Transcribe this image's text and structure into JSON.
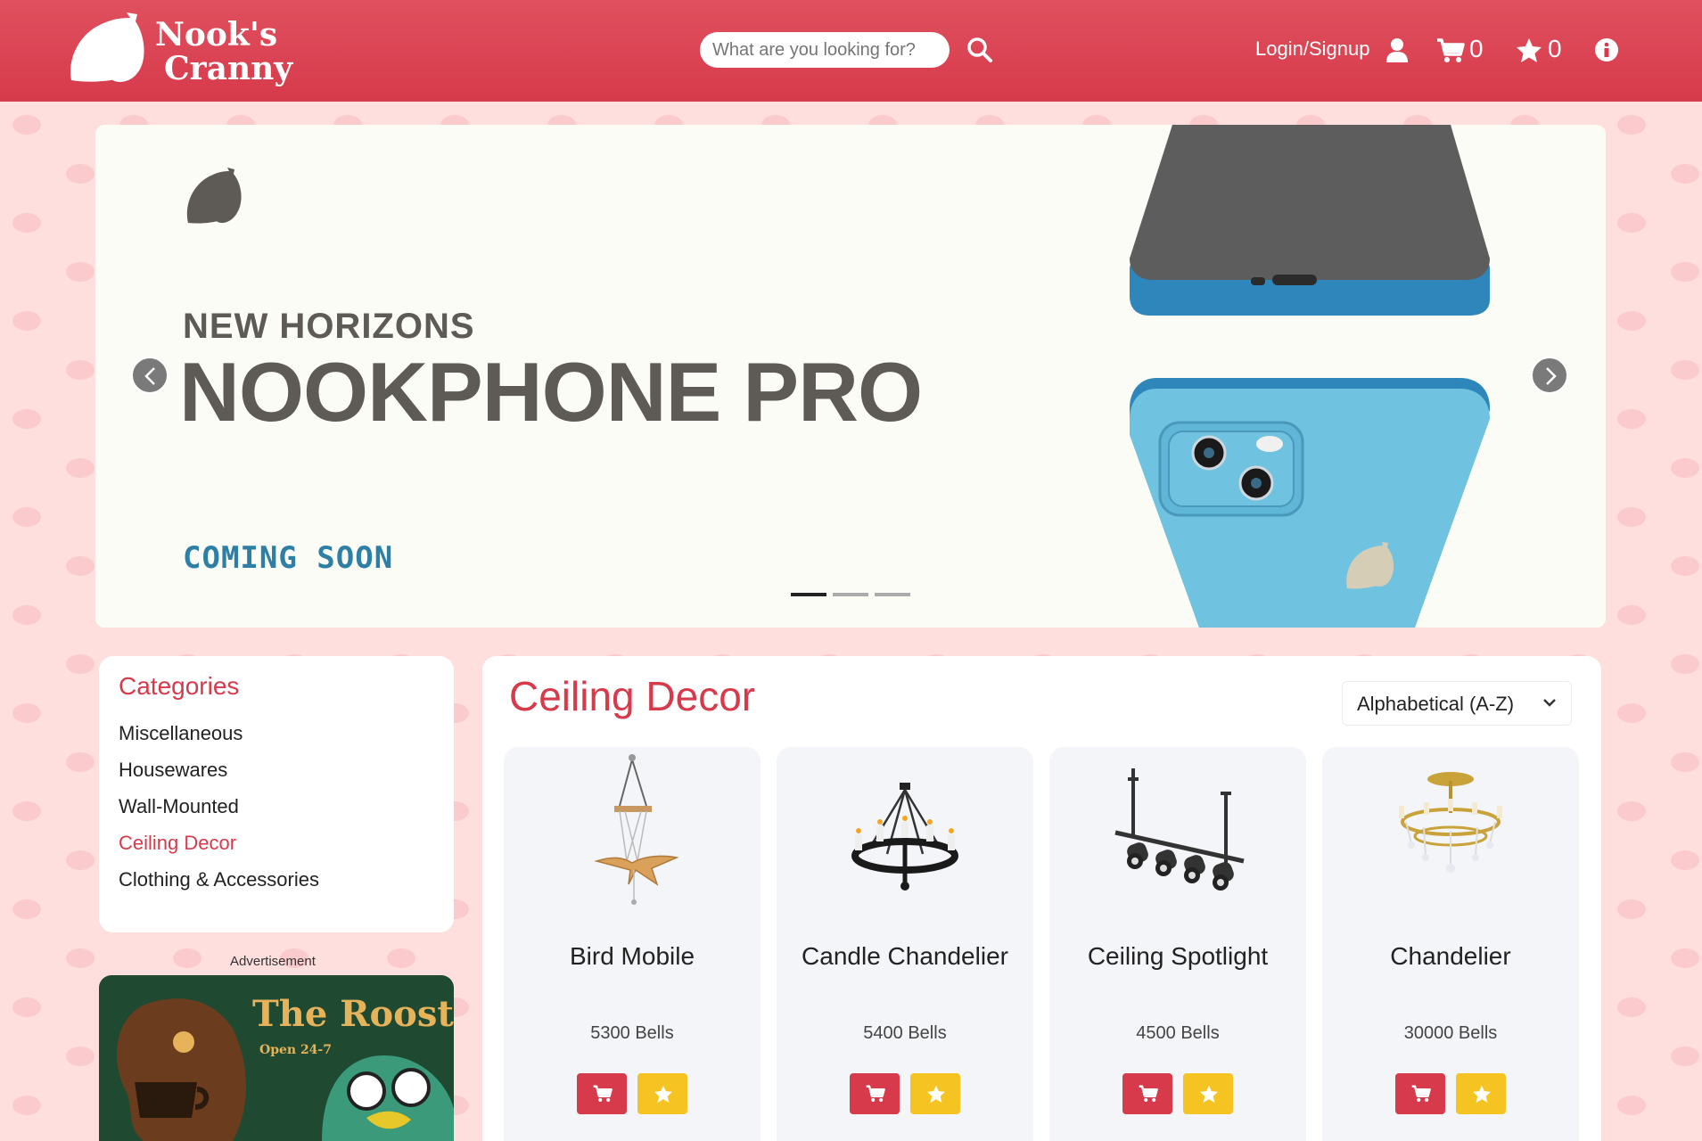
{
  "header": {
    "logo_line1": "Nook's",
    "logo_line2": "Cranny",
    "search_placeholder": "What are you looking for?",
    "login_label": "Login/Signup",
    "cart_count": "0",
    "favorites_count": "0",
    "brand_color": "#d63a4b"
  },
  "banner": {
    "subtitle": "NEW HORIZONS",
    "title": "NOOKPHONE PRO",
    "tagline": "COMING SOON",
    "slide_count": 3,
    "active_slide": 1
  },
  "categories": {
    "title": "Categories",
    "items": [
      {
        "label": "Miscellaneous",
        "active": false
      },
      {
        "label": "Housewares",
        "active": false
      },
      {
        "label": "Wall-Mounted",
        "active": false
      },
      {
        "label": "Ceiling Decor",
        "active": true
      },
      {
        "label": "Clothing & Accessories",
        "active": false
      }
    ]
  },
  "advertisement": {
    "label": "Advertisement",
    "title": "The Roost",
    "subtitle": "Open 24-7"
  },
  "products": {
    "title": "Ceiling Decor",
    "sort_label": "Alphabetical (A-Z)",
    "items": [
      {
        "name": "Bird Mobile",
        "price": "5300 Bells",
        "icon": "bird-mobile"
      },
      {
        "name": "Candle Chandelier",
        "price": "5400 Bells",
        "icon": "candle-chandelier"
      },
      {
        "name": "Ceiling Spotlight",
        "price": "4500 Bells",
        "icon": "ceiling-spotlight"
      },
      {
        "name": "Chandelier",
        "price": "30000 Bells",
        "icon": "chandelier"
      }
    ]
  }
}
